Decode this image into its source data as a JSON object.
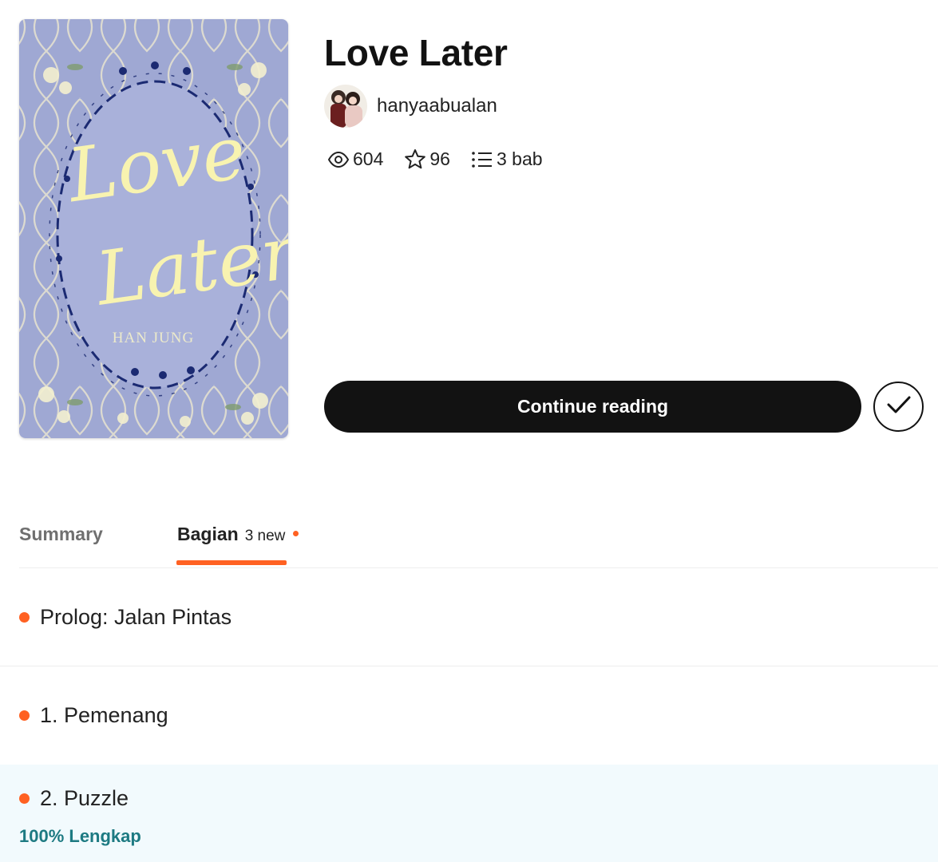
{
  "story": {
    "title": "Love Later",
    "author": "hanyaabualan"
  },
  "cover": {
    "title_line1": "Love",
    "title_line2": "Later",
    "author_line": "HAN JUNG",
    "colors": {
      "background": "#9fa8d3",
      "script": "#f8f3b0",
      "wreath": "#1b2a72"
    }
  },
  "stats": {
    "reads": "604",
    "votes": "96",
    "parts": "3 bab",
    "icons": [
      "eye-icon",
      "star-icon",
      "list-icon"
    ]
  },
  "actions": {
    "continue_label": "Continue reading",
    "library_icon": "checkmark-icon"
  },
  "tabs": {
    "summary_label": "Summary",
    "parts_label": "Bagian",
    "parts_new": "3 new"
  },
  "parts": [
    {
      "title": "Prolog: Jalan Pintas"
    },
    {
      "title": "1. Pemenang"
    },
    {
      "title": "2. Puzzle",
      "progress": "100% Lengkap"
    }
  ],
  "colors": {
    "accent": "#ff6122",
    "button": "#121212",
    "progress": "#1d7a82",
    "highlight_row": "#f2fafd"
  }
}
